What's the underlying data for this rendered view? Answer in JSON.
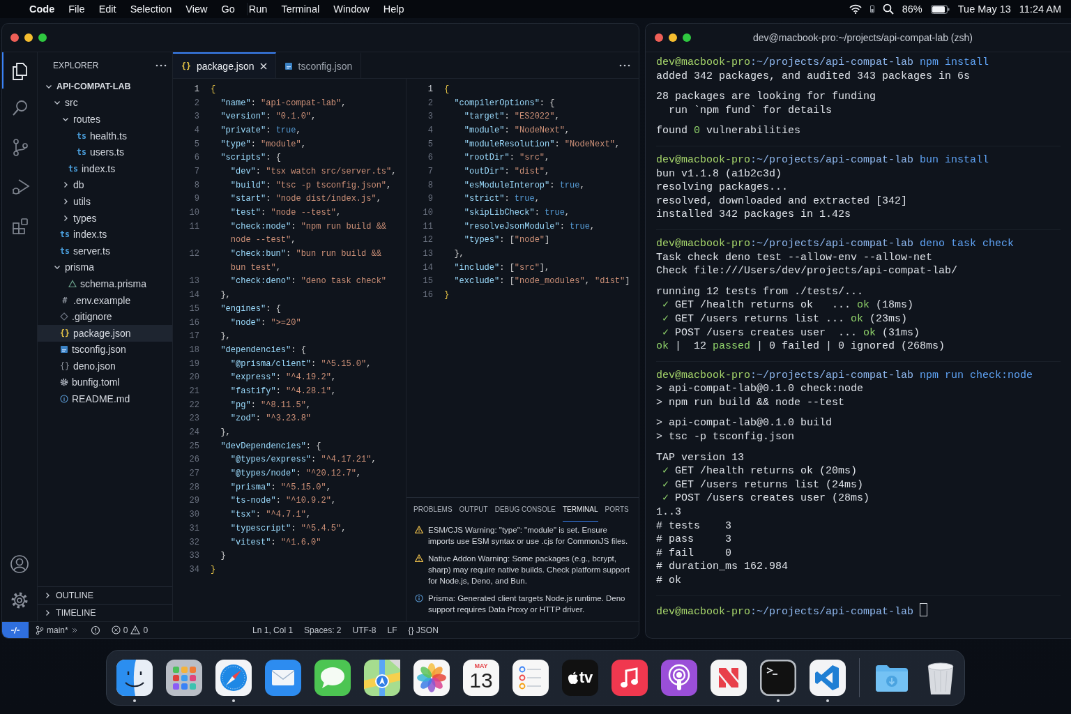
{
  "menu_bar": {
    "app": "Code",
    "menus": [
      "File",
      "Edit",
      "Selection",
      "View",
      "Go",
      "Run",
      "Terminal",
      "Window",
      "Help"
    ],
    "battery": "86%",
    "date": "Tue May 13",
    "time": "11:24 AM"
  },
  "editor_window": {
    "activity_bar": [
      {
        "kind": "explorer",
        "selected": true
      },
      {
        "kind": "search",
        "selected": false
      },
      {
        "kind": "source-control",
        "selected": false
      },
      {
        "kind": "run-debug",
        "selected": false
      },
      {
        "kind": "extensions",
        "selected": false
      }
    ],
    "sidebar": {
      "title": "EXPLORER",
      "tree": [
        {
          "name": "API-COMPAT-LAB",
          "kind": "folder",
          "expanded": true,
          "selected": false,
          "children": [
            {
              "name": "src",
              "kind": "folder",
              "expanded": true,
              "selected": false,
              "children": [
                {
                  "name": "routes",
                  "kind": "folder",
                  "expanded": true,
                  "selected": false,
                  "children": [
                    {
                      "name": "health.ts",
                      "kind": "ts",
                      "glyph": "ts",
                      "selected": false
                    },
                    {
                      "name": "users.ts",
                      "kind": "ts",
                      "glyph": "ts",
                      "selected": false
                    }
                  ]
                },
                {
                  "name": "index.ts",
                  "kind": "ts",
                  "glyph": "ts",
                  "selected": false
                },
                {
                  "name": "db",
                  "kind": "folder",
                  "expanded": false,
                  "selected": false
                },
                {
                  "name": "utils",
                  "kind": "folder",
                  "expanded": false,
                  "selected": false
                },
                {
                  "name": "types",
                  "kind": "folder",
                  "expanded": false,
                  "selected": false
                }
              ]
            },
            {
              "name": "index.ts",
              "kind": "ts",
              "glyph": "ts",
              "selected": false
            },
            {
              "name": "server.ts",
              "kind": "ts",
              "glyph": "ts",
              "selected": false
            },
            {
              "name": "prisma",
              "kind": "folder",
              "expanded": true,
              "selected": false,
              "children": [
                {
                  "name": "schema.prisma",
                  "kind": "prisma",
                  "selected": false
                }
              ]
            },
            {
              "name": ".env.example",
              "kind": "env",
              "glyph": "#",
              "selected": false
            },
            {
              "name": ".gitignore",
              "kind": "git",
              "selected": false
            },
            {
              "name": "package.json",
              "kind": "json",
              "glyph": "{}",
              "selected": true
            },
            {
              "name": "tsconfig.json",
              "kind": "tsconfig",
              "selected": false
            },
            {
              "name": "deno.json",
              "kind": "deno",
              "glyph": "{}",
              "selected": false
            },
            {
              "name": "bunfig.toml",
              "kind": "toml",
              "selected": false
            },
            {
              "name": "README.md",
              "kind": "md",
              "selected": false
            }
          ]
        }
      ],
      "sections": [
        {
          "name": "OUTLINE",
          "expanded": false
        },
        {
          "name": "TIMELINE",
          "expanded": false
        }
      ]
    },
    "tabs": [
      {
        "label": "package.json",
        "kind": "json",
        "glyph": "{}",
        "selected": true
      },
      {
        "label": "tsconfig.json",
        "kind": "tsconfig",
        "selected": false
      }
    ],
    "panes": [
      {
        "lines": [
          {
            "n": "1",
            "text": "{"
          },
          {
            "n": "2",
            "text": "  \"name\": \"api-compat-lab\","
          },
          {
            "n": "3",
            "text": "  \"version\": \"0.1.0\","
          },
          {
            "n": "4",
            "text": "  \"private\": true,"
          },
          {
            "n": "5",
            "text": "  \"type\": \"module\","
          },
          {
            "n": "6",
            "text": "  \"scripts\": {"
          },
          {
            "n": "7",
            "text": "    \"dev\": \"tsx watch src/server.ts\","
          },
          {
            "n": "8",
            "text": "    \"build\": \"tsc -p tsconfig.json\","
          },
          {
            "n": "9",
            "text": "    \"start\": \"node dist/index.js\","
          },
          {
            "n": "10",
            "text": "    \"test\": \"node --test\","
          },
          {
            "n": "11",
            "text": "    \"check:node\": \"npm run build &&"
          },
          {
            "text": "    node --test\","
          },
          {
            "n": "12",
            "text": "    \"check:bun\": \"bun run build &&"
          },
          {
            "text": "    bun test\","
          },
          {
            "n": "13",
            "text": "    \"check:deno\": \"deno task check\""
          },
          {
            "n": "14",
            "text": "  },"
          },
          {
            "n": "15",
            "text": "  \"engines\": {"
          },
          {
            "n": "16",
            "text": "    \"node\": \">=20\""
          },
          {
            "n": "17",
            "text": "  },"
          },
          {
            "n": "18",
            "text": "  \"dependencies\": {"
          },
          {
            "n": "19",
            "text": "    \"@prisma/client\": \"^5.15.0\","
          },
          {
            "n": "20",
            "text": "    \"express\": \"^4.19.2\","
          },
          {
            "n": "21",
            "text": "    \"fastify\": \"^4.28.1\","
          },
          {
            "n": "22",
            "text": "    \"pg\": \"^8.11.5\","
          },
          {
            "n": "23",
            "text": "    \"zod\": \"^3.23.8\""
          },
          {
            "n": "24",
            "text": "  },"
          },
          {
            "n": "25",
            "text": "  \"devDependencies\": {"
          },
          {
            "n": "26",
            "text": "    \"@types/express\": \"^4.17.21\","
          },
          {
            "n": "27",
            "text": "    \"@types/node\": \"^20.12.7\","
          },
          {
            "n": "28",
            "text": "    \"prisma\": \"^5.15.0\","
          },
          {
            "n": "29",
            "text": "    \"ts-node\": \"^10.9.2\","
          },
          {
            "n": "30",
            "text": "    \"tsx\": \"^4.7.1\","
          },
          {
            "n": "31",
            "text": "    \"typescript\": \"^5.4.5\","
          },
          {
            "n": "32",
            "text": "    \"vitest\": \"^1.6.0\""
          },
          {
            "n": "33",
            "text": "  }"
          },
          {
            "n": "34",
            "text": "}"
          }
        ]
      },
      {
        "lines": [
          {
            "n": "1",
            "text": "{"
          },
          {
            "n": "2",
            "text": "  \"compilerOptions\": {"
          },
          {
            "n": "3",
            "text": "    \"target\": \"ES2022\","
          },
          {
            "n": "4",
            "text": "    \"module\": \"NodeNext\","
          },
          {
            "n": "5",
            "text": "    \"moduleResolution\": \"NodeNext\","
          },
          {
            "n": "6",
            "text": "    \"rootDir\": \"src\","
          },
          {
            "n": "7",
            "text": "    \"outDir\": \"dist\","
          },
          {
            "n": "8",
            "text": "    \"esModuleInterop\": true,"
          },
          {
            "n": "9",
            "text": "    \"strict\": true,"
          },
          {
            "n": "10",
            "text": "    \"skipLibCheck\": true,"
          },
          {
            "n": "11",
            "text": "    \"resolveJsonModule\": true,"
          },
          {
            "n": "12",
            "text": "    \"types\": [\"node\"]"
          },
          {
            "n": "13",
            "text": "  },"
          },
          {
            "n": "14",
            "text": "  \"include\": [\"src\"],"
          },
          {
            "n": "15",
            "text": "  \"exclude\": [\"node_modules\", \"dist\"]"
          },
          {
            "n": "16",
            "text": "}"
          }
        ]
      }
    ],
    "panel": {
      "tabs": [
        {
          "label": "PROBLEMS",
          "selected": false
        },
        {
          "label": "OUTPUT",
          "selected": false
        },
        {
          "label": "DEBUG CONSOLE",
          "selected": false
        },
        {
          "label": "TERMINAL",
          "selected": true
        },
        {
          "label": "PORTS",
          "selected": false
        }
      ],
      "messages": [
        {
          "kind": "warning",
          "text": "ESM/CJS Warning: \"type\": \"module\"  is set. Ensure imports use ESM syntax or use .cjs for CommonJS files."
        },
        {
          "kind": "warning",
          "text": "Native Addon Warning: Some packages (e.g., bcrypt, sharp) may require native builds. Check platform support for Node.js, Deno, and Bun."
        },
        {
          "kind": "info",
          "text": "Prisma: Generated client targets Node.js  runtime. Deno support requires Data Proxy or HTTP driver."
        }
      ]
    },
    "status_bar": {
      "branch": "main*",
      "errors": "0",
      "warnings": "0",
      "items": [
        "Ln 1, Col 1",
        "Spaces: 2",
        "UTF-8",
        "LF",
        "{} JSON"
      ]
    }
  },
  "terminal_window": {
    "title": "dev@macbook-pro:~/projects/api-compat-lab (zsh)",
    "blocks": [
      {
        "user": "dev@macbook-pro",
        "path": ":~/projects/api-compat-lab",
        "command": "npm install",
        "groups": [
          [
            {
              "parts": [
                {
                  "text": "added 342 packages, and audited 343 packages in 6s"
                }
              ]
            }
          ],
          [
            {
              "parts": [
                {
                  "text": "28 packages are looking for funding"
                }
              ]
            },
            {
              "parts": [
                {
                  "text": "  run `npm fund` for details"
                }
              ]
            }
          ],
          [
            {
              "parts": [
                {
                  "text": "found "
                },
                {
                  "text": "0",
                  "kind": "success"
                },
                {
                  "text": " vulnerabilities"
                }
              ]
            }
          ]
        ]
      },
      {
        "user": "dev@macbook-pro",
        "path": ":~/projects/api-compat-lab",
        "command": "bun install",
        "groups": [
          [
            {
              "parts": [
                {
                  "text": "bun v1.1.8 (a1b2c3d)"
                }
              ]
            },
            {
              "parts": [
                {
                  "text": "resolving packages..."
                }
              ]
            },
            {
              "parts": [
                {
                  "text": "resolved, downloaded and extracted [342]"
                }
              ]
            },
            {
              "parts": [
                {
                  "text": "installed 342 packages in 1.42s"
                }
              ]
            }
          ]
        ]
      },
      {
        "user": "dev@macbook-pro",
        "path": ":~/projects/api-compat-lab",
        "command": "deno task check",
        "groups": [
          [
            {
              "parts": [
                {
                  "text": "Task check deno test --allow-env --allow-net"
                }
              ]
            },
            {
              "parts": [
                {
                  "text": "Check file:///Users/dev/projects/api-compat-lab/"
                }
              ]
            }
          ],
          [
            {
              "parts": [
                {
                  "text": "running 12 tests from ./tests/..."
                }
              ]
            },
            {
              "parts": [
                {
                  "text": " ✓",
                  "kind": "success"
                },
                {
                  "text": " GET /health returns ok   ... "
                },
                {
                  "text": "ok",
                  "kind": "success"
                },
                {
                  "text": " (18ms)"
                }
              ]
            },
            {
              "parts": [
                {
                  "text": " ✓",
                  "kind": "success"
                },
                {
                  "text": " GET /users returns list ... "
                },
                {
                  "text": "ok",
                  "kind": "success"
                },
                {
                  "text": " (23ms)"
                }
              ]
            },
            {
              "parts": [
                {
                  "text": " ✓",
                  "kind": "success"
                },
                {
                  "text": " POST /users creates user  ... "
                },
                {
                  "text": "ok",
                  "kind": "success"
                },
                {
                  "text": " (31ms)"
                }
              ]
            },
            {
              "parts": [
                {
                  "text": "ok",
                  "kind": "success"
                },
                {
                  "text": " |  12 "
                },
                {
                  "text": "passed",
                  "kind": "success"
                },
                {
                  "text": " | 0 failed | 0 ignored (268ms)"
                }
              ]
            }
          ]
        ]
      },
      {
        "user": "dev@macbook-pro",
        "path": ":~/projects/api-compat-lab",
        "command": "npm run check:node",
        "groups": [
          [
            {
              "parts": [
                {
                  "text": "> api-compat-lab@0.1.0 check:node"
                }
              ]
            },
            {
              "parts": [
                {
                  "text": "> npm run build && node --test"
                }
              ]
            }
          ],
          [
            {
              "parts": [
                {
                  "text": "> api-compat-lab@0.1.0 build"
                }
              ]
            },
            {
              "parts": [
                {
                  "text": "> tsc -p tsconfig.json"
                }
              ]
            }
          ],
          [
            {
              "parts": [
                {
                  "text": "TAP version 13"
                }
              ]
            },
            {
              "parts": [
                {
                  "text": " ✓",
                  "kind": "success"
                },
                {
                  "text": " GET /health returns ok (20ms)"
                }
              ]
            },
            {
              "parts": [
                {
                  "text": " ✓",
                  "kind": "success"
                },
                {
                  "text": " GET /users returns list (24ms)"
                }
              ]
            },
            {
              "parts": [
                {
                  "text": " ✓",
                  "kind": "success"
                },
                {
                  "text": " POST /users creates user (28ms)"
                }
              ]
            },
            {
              "parts": [
                {
                  "text": "1..3"
                }
              ]
            },
            {
              "parts": [
                {
                  "text": "# tests    3"
                }
              ]
            },
            {
              "parts": [
                {
                  "text": "# pass     3"
                }
              ]
            },
            {
              "parts": [
                {
                  "text": "# fail     0"
                }
              ]
            },
            {
              "parts": [
                {
                  "text": "# duration_ms 162.984"
                }
              ]
            },
            {
              "parts": [
                {
                  "text": "# ok"
                }
              ]
            }
          ]
        ]
      }
    ],
    "final_prompt": {
      "user": "dev@macbook-pro",
      "path": ":~/projects/api-compat-lab"
    }
  },
  "dock": {
    "apps": [
      {
        "kind": "finder",
        "running": true
      },
      {
        "kind": "launchpad",
        "running": false
      },
      {
        "kind": "safari",
        "running": true
      },
      {
        "kind": "mail",
        "running": false
      },
      {
        "kind": "messages",
        "running": false
      },
      {
        "kind": "maps",
        "running": false
      },
      {
        "kind": "photos",
        "running": false
      },
      {
        "kind": "calendar",
        "month": "MAY",
        "day": "13",
        "running": false
      },
      {
        "kind": "reminders",
        "running": false
      },
      {
        "kind": "tv",
        "label": "tv",
        "running": false
      },
      {
        "kind": "music",
        "running": false
      },
      {
        "kind": "podcasts",
        "running": false
      },
      {
        "kind": "news",
        "running": false
      },
      {
        "kind": "terminal",
        "running": true
      },
      {
        "kind": "vscode",
        "running": true
      }
    ],
    "stacks": [
      {
        "kind": "downloads"
      },
      {
        "kind": "trash"
      }
    ]
  }
}
